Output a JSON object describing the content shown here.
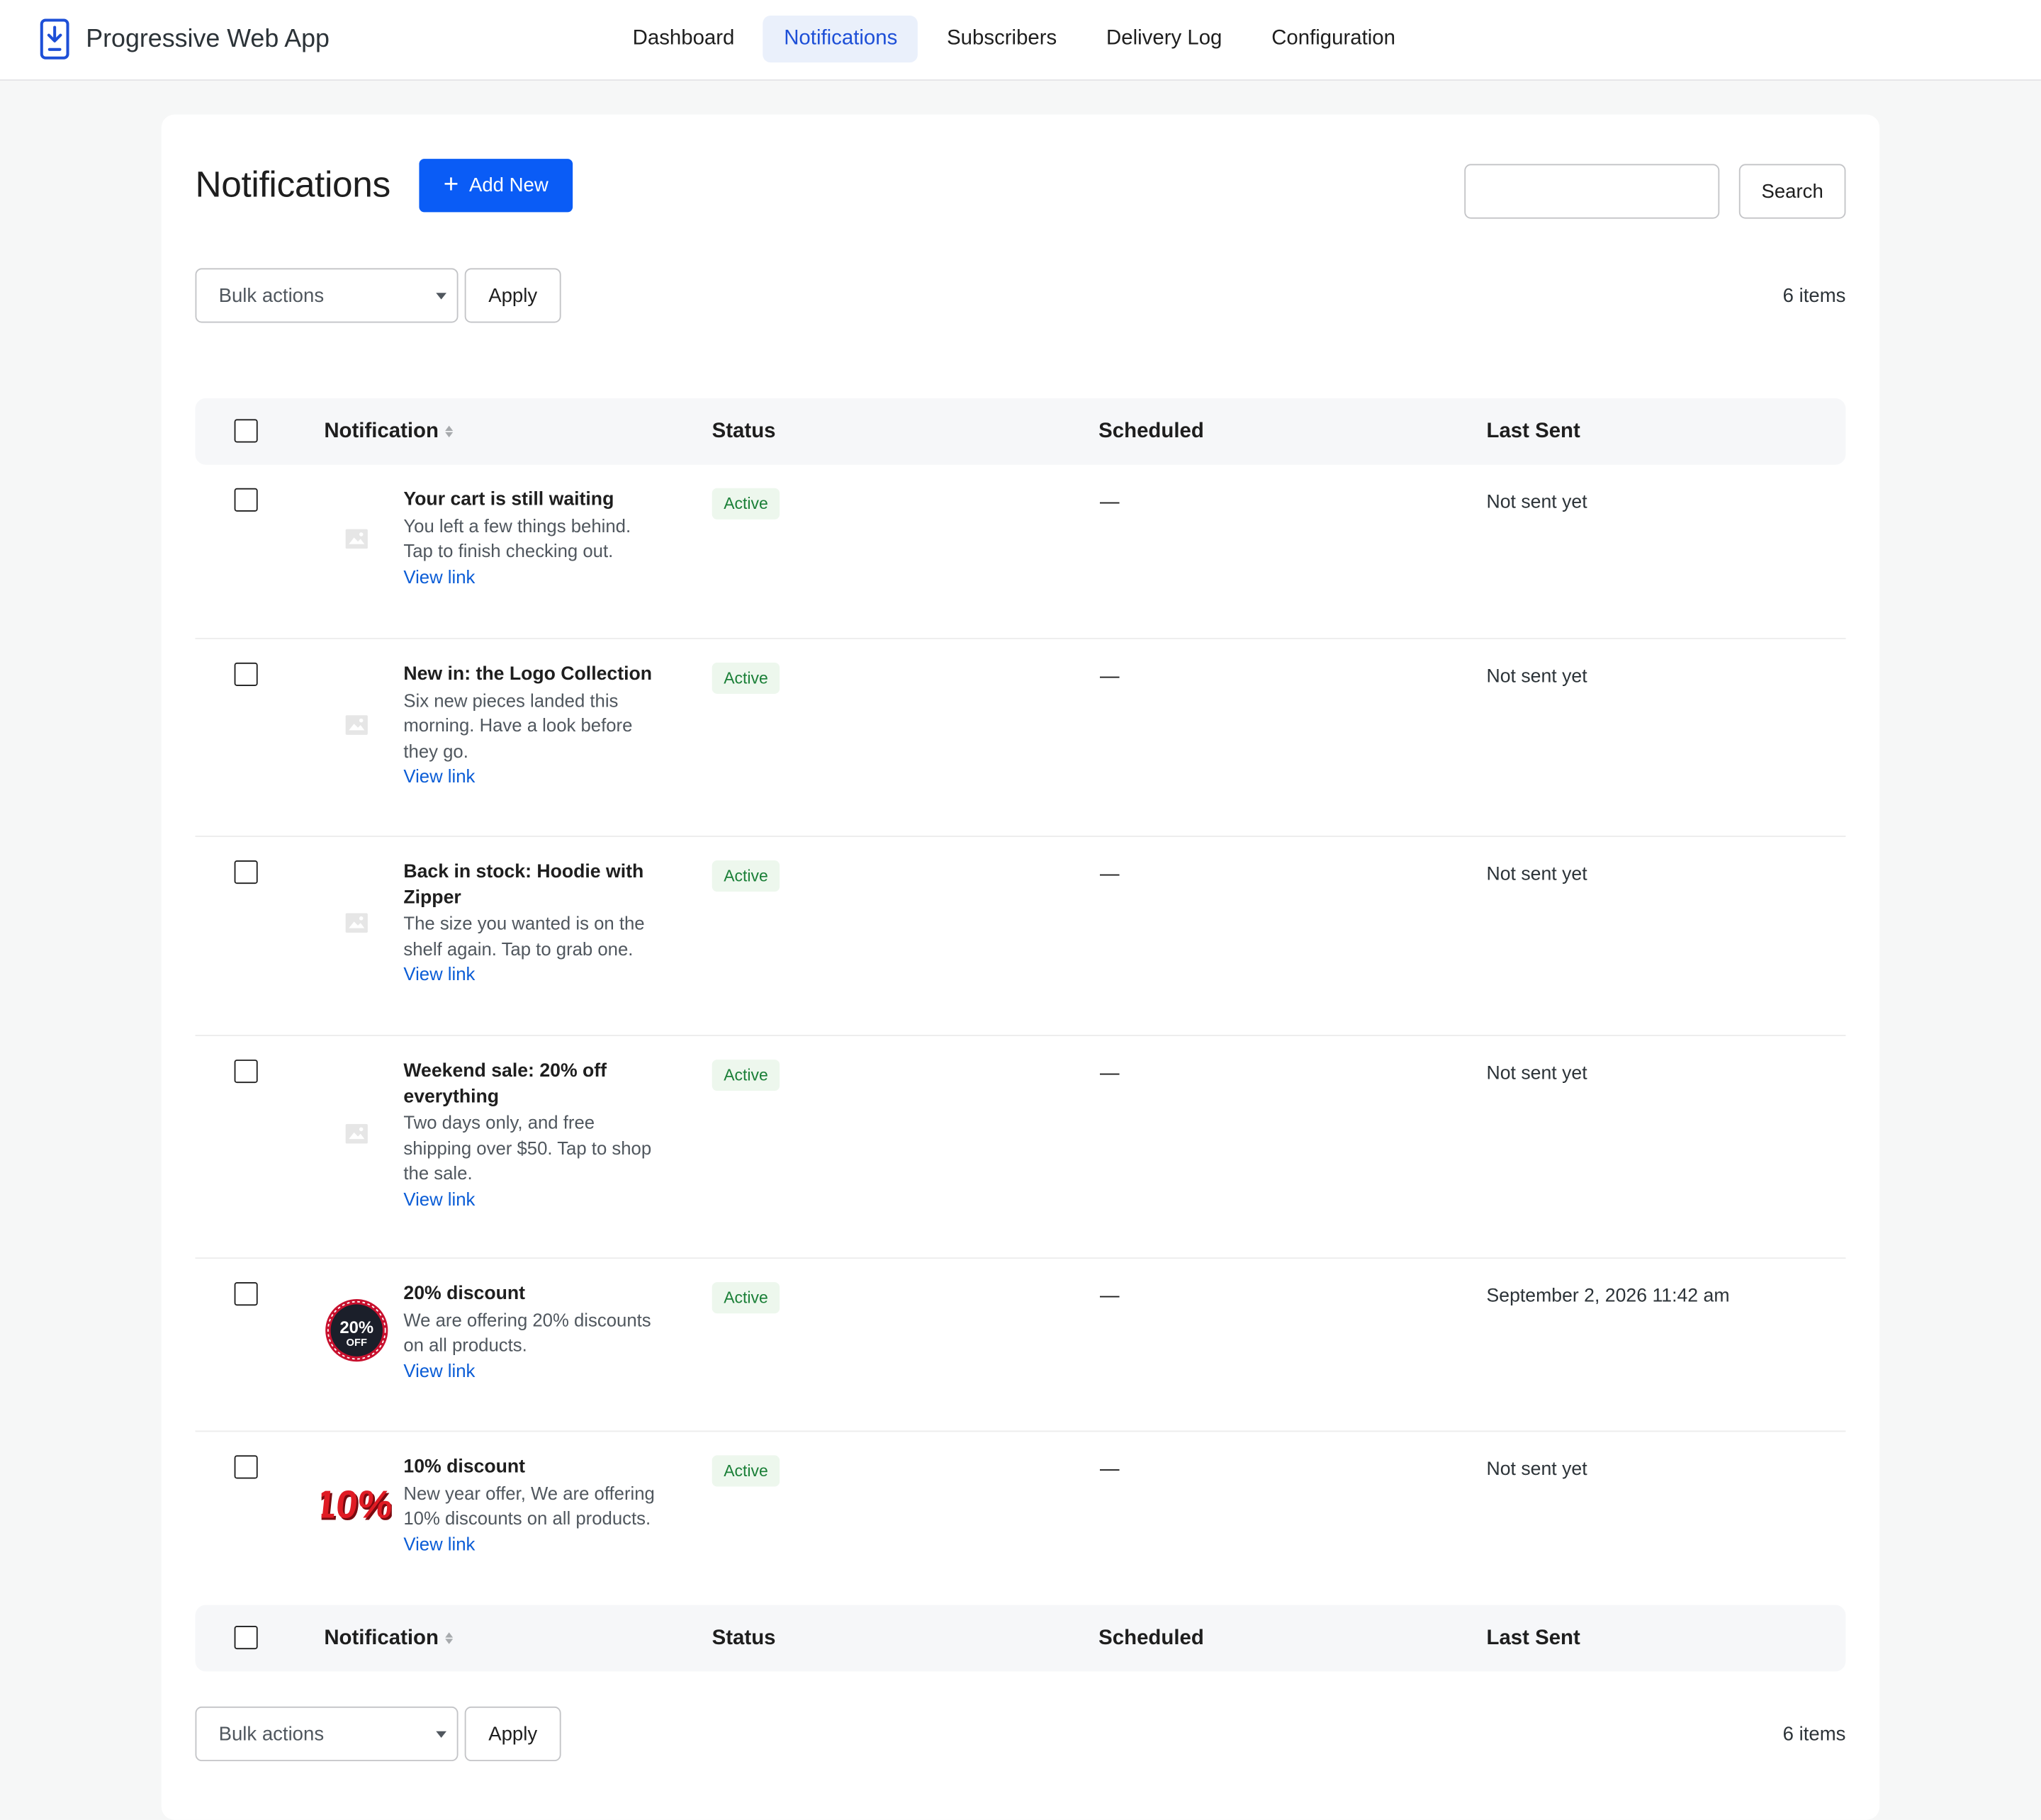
{
  "app": {
    "name": "Progressive Web App"
  },
  "nav": [
    {
      "label": "Dashboard",
      "active": false
    },
    {
      "label": "Notifications",
      "active": true
    },
    {
      "label": "Subscribers",
      "active": false
    },
    {
      "label": "Delivery Log",
      "active": false
    },
    {
      "label": "Configuration",
      "active": false
    }
  ],
  "page": {
    "title": "Notifications",
    "add_new_label": "Add New",
    "search": {
      "value": "",
      "button_label": "Search"
    }
  },
  "bulk": {
    "label": "Bulk actions",
    "apply_label": "Apply",
    "count": "6 items"
  },
  "table": {
    "columns": {
      "notification": "Notification",
      "status": "Status",
      "scheduled": "Scheduled",
      "last_sent": "Last Sent"
    },
    "rows": [
      {
        "title": "Your cart is still waiting",
        "description": "You left a few things behind. Tap to finish checking out.",
        "link_label": "View link",
        "status": "Active",
        "scheduled": "—",
        "last_sent": "Not sent yet",
        "image": "placeholder-image"
      },
      {
        "title": "New in: the Logo Collection",
        "description": "Six new pieces landed this morning. Have a look before they go.",
        "link_label": "View link",
        "status": "Active",
        "scheduled": "—",
        "last_sent": "Not sent yet",
        "image": "placeholder-image"
      },
      {
        "title": "Back in stock: Hoodie with Zipper",
        "description": "The size you wanted is on the shelf again. Tap to grab one.",
        "link_label": "View link",
        "status": "Active",
        "scheduled": "—",
        "last_sent": "Not sent yet",
        "image": "placeholder-image"
      },
      {
        "title": "Weekend sale: 20% off everything",
        "description": "Two days only, and free shipping over $50. Tap to shop the sale.",
        "link_label": "View link",
        "status": "Active",
        "scheduled": "—",
        "last_sent": "Not sent yet",
        "image": "placeholder-image"
      },
      {
        "title": "20% discount",
        "description": "We are offering 20% discounts on all products.",
        "link_label": "View link",
        "status": "Active",
        "scheduled": "—",
        "last_sent": "September 2, 2026 11:42 am",
        "image": "20-off-badge",
        "image_text": "20%",
        "image_subtext": "OFF"
      },
      {
        "title": "10% discount",
        "description": "New year offer, We are offering 10% discounts on all products.",
        "link_label": "View link",
        "status": "Active",
        "scheduled": "—",
        "last_sent": "Not sent yet",
        "image": "10-percent-graphic",
        "image_text": "10%"
      }
    ]
  },
  "colors": {
    "primary": "#0a5cf6",
    "nav_active_bg": "#eaf0fb",
    "status_active_bg": "#edf7ed",
    "status_active_text": "#1a7f37",
    "link": "#0a5cd6"
  }
}
